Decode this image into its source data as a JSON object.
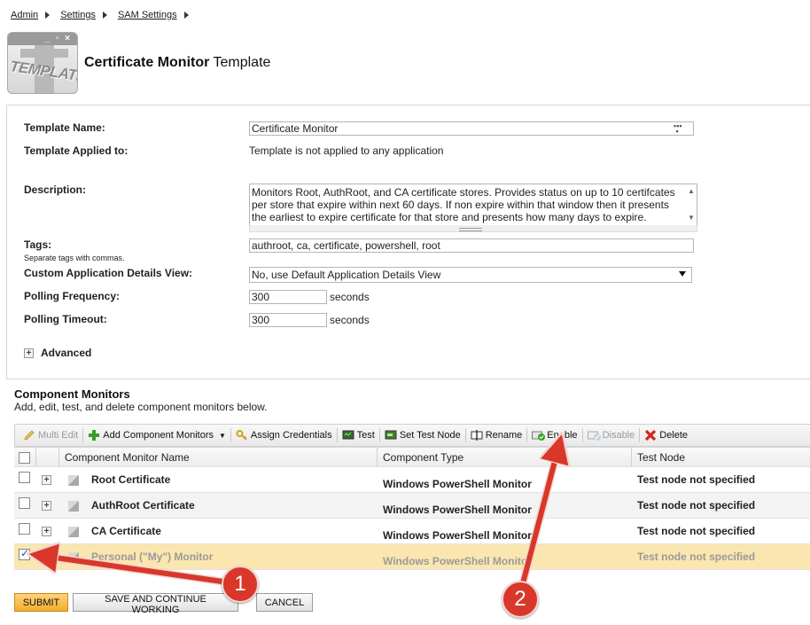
{
  "breadcrumb": [
    "Admin",
    "Settings",
    "SAM Settings"
  ],
  "icon_text": "TEMPLATE",
  "page_title": {
    "bold": "Certificate Monitor",
    "rest": " Template"
  },
  "form": {
    "template_name_label": "Template Name:",
    "template_name_value": "Certificate Monitor",
    "applied_label": "Template Applied to:",
    "applied_value": "Template is not applied to any application",
    "description_label": "Description:",
    "description_value": "Monitors Root, AuthRoot, and CA certificate stores. Provides status on up to 10 certifcates per store that expire within next 60 days. If non expire within that window then it presents the earliest to expire certificate for that store and presents how many days to expire.",
    "tags_label": "Tags:",
    "tags_hint": "Separate tags with commas.",
    "tags_value": "authroot, ca, certificate, powershell, root",
    "details_view_label": "Custom Application Details View:",
    "details_view_value": "No, use Default Application Details View",
    "polling_frequency_label": "Polling Frequency:",
    "polling_frequency_value": "300",
    "polling_timeout_label": "Polling Timeout:",
    "polling_timeout_value": "300",
    "seconds": "seconds",
    "advanced_label": "Advanced"
  },
  "component_monitors": {
    "title": "Component Monitors",
    "subtitle": "Add, edit, test, and delete component monitors below."
  },
  "toolbar": {
    "multi_edit": "Multi Edit",
    "add_component": "Add Component Monitors",
    "assign_credentials": "Assign Credentials",
    "test": "Test",
    "set_test_node": "Set Test Node",
    "rename": "Rename",
    "enable": "Enable",
    "disable": "Disable",
    "delete": "Delete"
  },
  "grid": {
    "headers": {
      "name": "Component Monitor Name",
      "type": "Component Type",
      "node": "Test Node"
    },
    "rows": [
      {
        "name": "Root Certificate",
        "type": "Windows PowerShell Monitor",
        "node": "Test node not specified",
        "checked": false
      },
      {
        "name": "AuthRoot Certificate",
        "type": "Windows PowerShell Monitor",
        "node": "Test node not specified",
        "checked": false
      },
      {
        "name": "CA Certificate",
        "type": "Windows PowerShell Monitor",
        "node": "Test node not specified",
        "checked": false
      },
      {
        "name": "Personal (\"My\") Monitor",
        "type": "Windows PowerShell Monitor",
        "node": "Test node not specified",
        "checked": true
      }
    ]
  },
  "buttons": {
    "submit": "SUBMIT",
    "save": "SAVE AND CONTINUE WORKING",
    "cancel": "CANCEL"
  },
  "callouts": [
    "1",
    "2"
  ],
  "colors": {
    "accent_arrow": "#d8372a",
    "selected_row": "#fbe6b0",
    "submit": "#f3ad2e"
  }
}
